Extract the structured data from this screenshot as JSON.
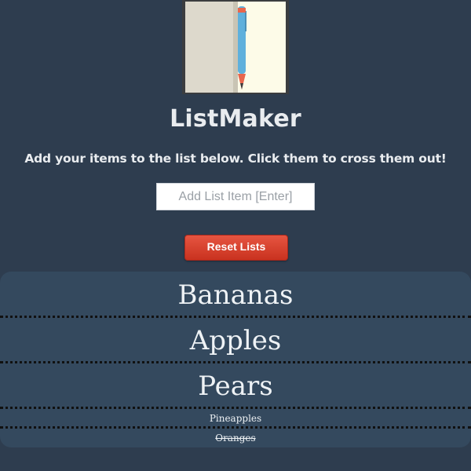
{
  "app": {
    "title": "ListMaker",
    "instructions": "Add your items to the list below. Click them to cross them out!"
  },
  "input": {
    "value": "",
    "placeholder": "Add List Item [Enter]"
  },
  "buttons": {
    "reset_label": "Reset Lists"
  },
  "list": {
    "items": [
      {
        "label": "Bananas",
        "crossed": false
      },
      {
        "label": "Apples",
        "crossed": false
      },
      {
        "label": "Pears",
        "crossed": false
      },
      {
        "label": "Pineapples",
        "crossed": false
      },
      {
        "label": "Oranges",
        "crossed": true
      }
    ]
  },
  "icons": {
    "logo": "notebook-with-pen-icon"
  },
  "colors": {
    "background": "#2e3d4f",
    "list_background": "#34495e",
    "reset_button": "#d63c2a",
    "pen": "#5fb0dc",
    "pen_tip": "#e8664d"
  }
}
